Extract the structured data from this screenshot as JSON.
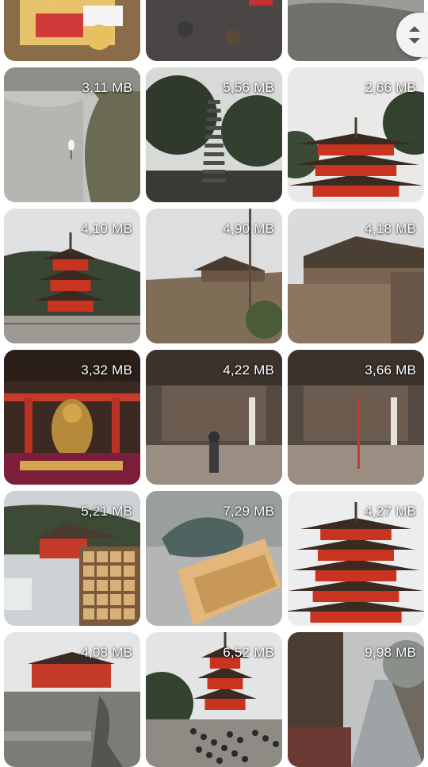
{
  "gallery": {
    "tiles": [
      {
        "size": "",
        "scene": "market"
      },
      {
        "size": "",
        "scene": "street"
      },
      {
        "size": "",
        "scene": "river-bird"
      },
      {
        "size": "3,11 MB",
        "scene": "heron-stream"
      },
      {
        "size": "5,56 MB",
        "scene": "stone-pagoda"
      },
      {
        "size": "2,66 MB",
        "scene": "red-pagoda"
      },
      {
        "size": "4,10 MB",
        "scene": "pagoda-hill"
      },
      {
        "size": "4,90 MB",
        "scene": "temple-valley"
      },
      {
        "size": "4,18 MB",
        "scene": "temple-stage"
      },
      {
        "size": "3,32 MB",
        "scene": "buddha-altar"
      },
      {
        "size": "4,22 MB",
        "scene": "shrine-person"
      },
      {
        "size": "3,66 MB",
        "scene": "shrine-hall"
      },
      {
        "size": "5,21 MB",
        "scene": "ema-plaques"
      },
      {
        "size": "7,29 MB",
        "scene": "dragon-fountain"
      },
      {
        "size": "4,27 MB",
        "scene": "pagoda-closeup"
      },
      {
        "size": "4,08 MB",
        "scene": "gate-statue"
      },
      {
        "size": "6,52 MB",
        "scene": "pagoda-crowd"
      },
      {
        "size": "9,98 MB",
        "scene": "canal-street"
      }
    ]
  },
  "scroll_handle": {
    "icon_up": "chevron-up-icon",
    "icon_down": "chevron-down-icon"
  },
  "colors": {
    "pagoda_red": "#c8341f",
    "label_text": "#ffffff",
    "handle_bg": "#f1f3f4"
  }
}
